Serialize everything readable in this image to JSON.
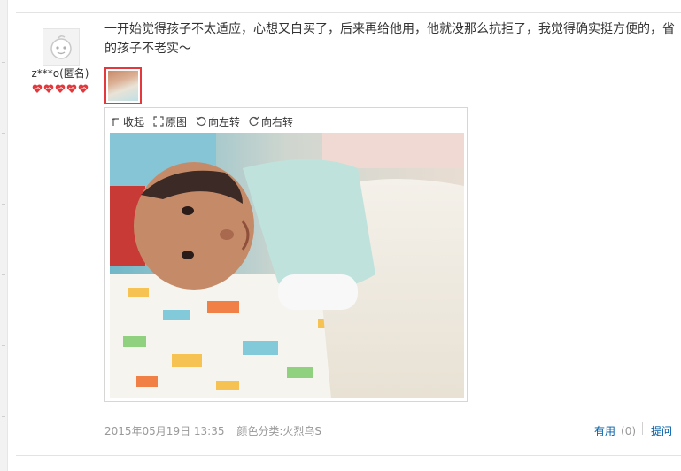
{
  "review": {
    "user": {
      "name": "z***o(匿名)",
      "level_hearts": 5,
      "avatar_icon": "baby-face-icon"
    },
    "text": "一开始觉得孩子不太适应，心想又白买了，后来再给他用，他就没那么抗拒了，我觉得确实挺方便的，省的孩子不老实～",
    "viewer": {
      "collapse_label": "收起",
      "original_label": "原图",
      "rotate_left_label": "向左转",
      "rotate_right_label": "向右转"
    },
    "date": "2015年05月19日 13:35",
    "color_label": "颜色分类:火烈鸟S",
    "useful_label": "有用",
    "useful_count": "(0)",
    "reply_label": "提问"
  },
  "colors": {
    "link": "#005ea7",
    "meta": "#999999",
    "thumb_border": "#e4393c",
    "heart": "#e4393c"
  }
}
